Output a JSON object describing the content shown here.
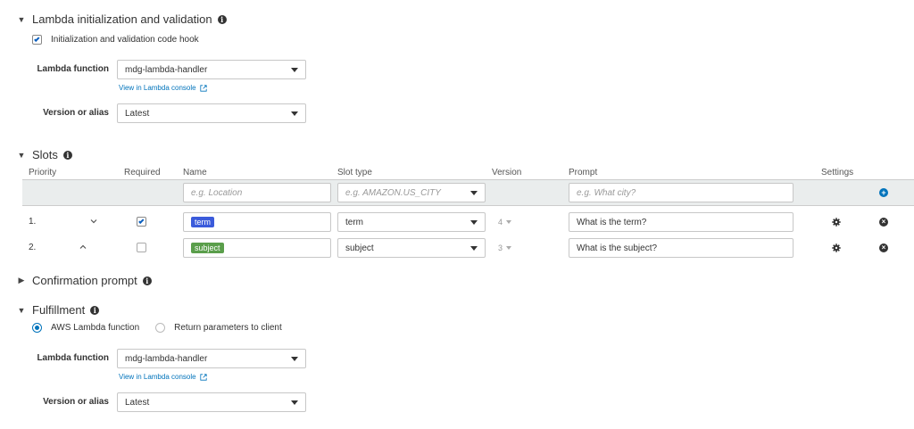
{
  "lambda_init": {
    "title": "Lambda initialization and validation",
    "hook_label": "Initialization and validation code hook",
    "hook_checked": true,
    "function_label": "Lambda function",
    "function_value": "mdg-lambda-handler",
    "console_link": "View in Lambda console",
    "version_label": "Version or alias",
    "version_value": "Latest"
  },
  "slots": {
    "title": "Slots",
    "columns": {
      "priority": "Priority",
      "required": "Required",
      "name": "Name",
      "slot_type": "Slot type",
      "version": "Version",
      "prompt": "Prompt",
      "settings": "Settings"
    },
    "new_row": {
      "name_placeholder": "e.g. Location",
      "slot_type_placeholder": "e.g. AMAZON.US_CITY",
      "prompt_placeholder": "e.g. What city?"
    },
    "rows": [
      {
        "priority": "1.",
        "move_icon": "chevron-down-icon",
        "required": true,
        "name": "term",
        "tag_color": "#3b5bdb",
        "slot_type": "term",
        "version": "4",
        "prompt": "What is the term?"
      },
      {
        "priority": "2.",
        "move_icon": "chevron-up-icon",
        "required": false,
        "name": "subject",
        "tag_color": "#5a9e4b",
        "slot_type": "subject",
        "version": "3",
        "prompt": "What is the subject?"
      }
    ]
  },
  "confirmation": {
    "title": "Confirmation prompt"
  },
  "fulfillment": {
    "title": "Fulfillment",
    "option_lambda": "AWS Lambda function",
    "option_client": "Return parameters to client",
    "selected": "AWS Lambda function",
    "function_label": "Lambda function",
    "function_value": "mdg-lambda-handler",
    "console_link": "View in Lambda console",
    "version_label": "Version or alias",
    "version_value": "Latest"
  },
  "colors": {
    "accent": "#0073bb",
    "header_row_bg": "#eaeded"
  }
}
